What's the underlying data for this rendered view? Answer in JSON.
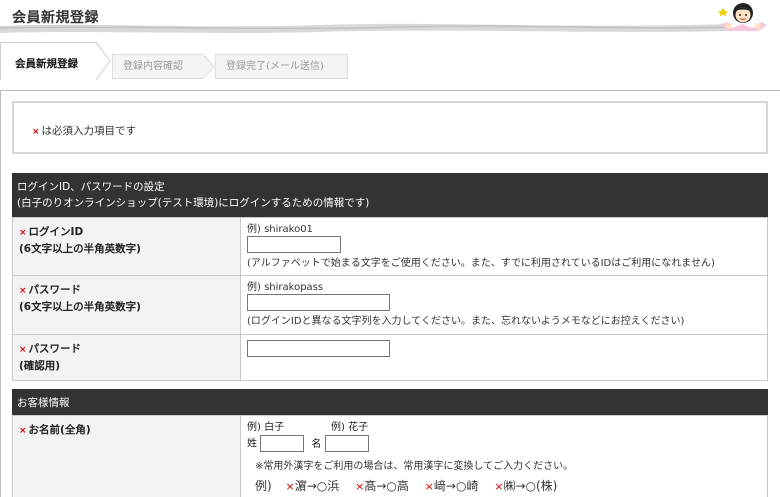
{
  "header": {
    "title": "会員新規登録"
  },
  "steps": [
    {
      "label": "会員新規登録",
      "active": true
    },
    {
      "label": "登録内容確認",
      "active": false
    },
    {
      "label": "登録完了(メール送信)",
      "active": false
    }
  ],
  "required_note": {
    "mark": "×",
    "text": "は必須入力項目です"
  },
  "sections": {
    "login": {
      "heading_line1": "ログインID、パスワードの設定",
      "heading_line2": "(白子のりオンラインショップ(テスト環境)にログインするための情報です)",
      "rows": {
        "login_id": {
          "label": "ログインID",
          "sublabel": "(6文字以上の半角英数字)",
          "example": "例) shirako01",
          "value": "",
          "hint": "(アルファベットで始まる文字をご使用ください。また、すでに利用されているIDはご利用になれません)"
        },
        "password": {
          "label": "パスワード",
          "sublabel": "(6文字以上の半角英数字)",
          "example": "例) shirakopass",
          "value": "",
          "hint": "(ログインIDと異なる文字列を入力してください。また、忘れないようメモなどにお控えください)"
        },
        "password_confirm": {
          "label": "パスワード",
          "sublabel": "(確認用)",
          "value": ""
        }
      }
    },
    "customer": {
      "heading": "お客様情報",
      "name": {
        "label": "お名前(全角)",
        "example_last": "例) 白子",
        "example_first": "例) 花子",
        "last_label": "姓",
        "first_label": "名",
        "last_value": "",
        "first_value": "",
        "note": "※常用外漢字をご利用の場合は、常用漢字に変換してご入力ください。",
        "examples_prefix": "例)",
        "examples": [
          "濵→○浜",
          "髙→○高",
          "﨑→○崎",
          "㈱→○(株)"
        ]
      }
    }
  },
  "colors": {
    "section_header_bg": "#333333",
    "required_mark": "#dd0000",
    "label_bg": "#f3f3f3"
  },
  "icons": {
    "mascot": "girl-mascot-icon",
    "required": "cross-mark-icon"
  }
}
